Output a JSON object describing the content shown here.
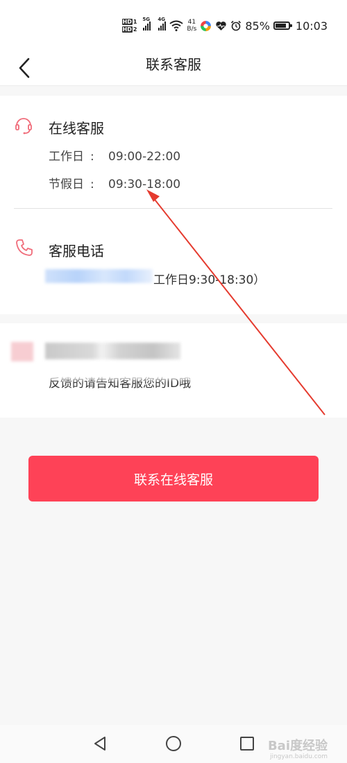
{
  "status_bar": {
    "hd1": "HD",
    "hd1_num": "1",
    "hd2": "HD",
    "hd2_num": "2",
    "net1": "5G",
    "net2": "4G",
    "speed_value": "41",
    "speed_unit": "B/s",
    "battery": "85%",
    "battery_level": 0.85,
    "time": "10:03"
  },
  "header": {
    "title": "联系客服"
  },
  "online_service": {
    "title": "在线客服",
    "workday_label": "工作日",
    "workday_sep": ":",
    "workday_hours": "09:00-22:00",
    "holiday_label": "节假日",
    "holiday_sep": ":",
    "holiday_hours": "09:30-18:00"
  },
  "phone_service": {
    "title": "客服电话",
    "hours": "工作日9:30-18:30）"
  },
  "feedback": {
    "line": "反馈的请告知客服您的ID哦"
  },
  "contact_button": {
    "label": "联系在线客服"
  },
  "watermark": {
    "text": "Bai度经验",
    "sub": "jingyan.baidu.com"
  },
  "colors": {
    "accent": "#fe4257",
    "icon": "#f06c7a",
    "annotation": "#e53b2f"
  }
}
